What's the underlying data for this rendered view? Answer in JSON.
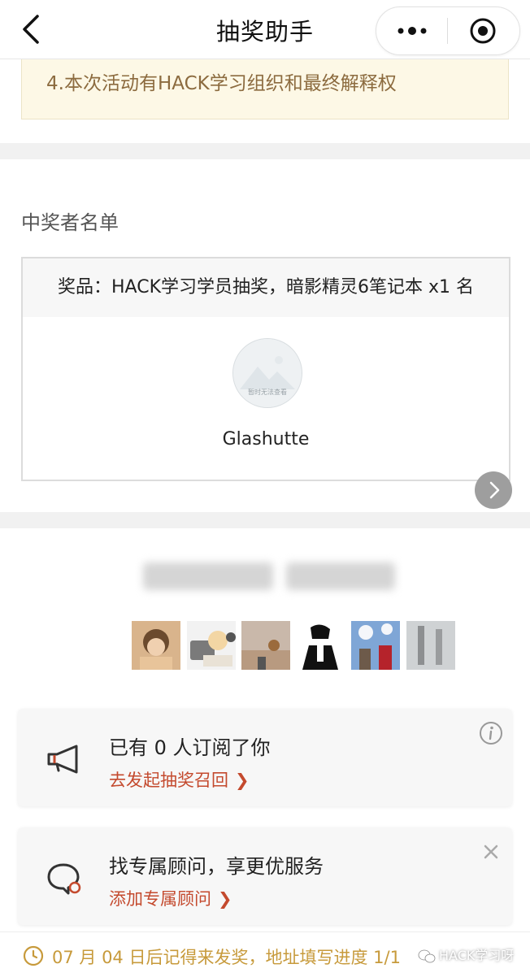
{
  "nav": {
    "title": "抽奖助手"
  },
  "notice": {
    "text": "4.本次活动有HACK学习组织和最终解释权"
  },
  "winners": {
    "section_title": "中奖者名单",
    "prize_text": "奖品：HACK学习学员抽奖，暗影精灵6笔记本 x1 名",
    "avatar_caption": "暂时无法查看",
    "winner_name": "Glashutte"
  },
  "subscribe_card": {
    "text": "已有 0 人订阅了你",
    "link": "去发起抽奖召回"
  },
  "advisor_card": {
    "text": "找专属顾问，享更优服务",
    "link": "添加专属顾问"
  },
  "bottom": {
    "message": "07 月 04 日后记得来发奖，地址填写进度 1/1",
    "watermark": "HACK学习呀"
  },
  "colors": {
    "accent": "#c44a2e",
    "gold": "#c79a3b",
    "notice_bg": "#fdf8e6"
  }
}
